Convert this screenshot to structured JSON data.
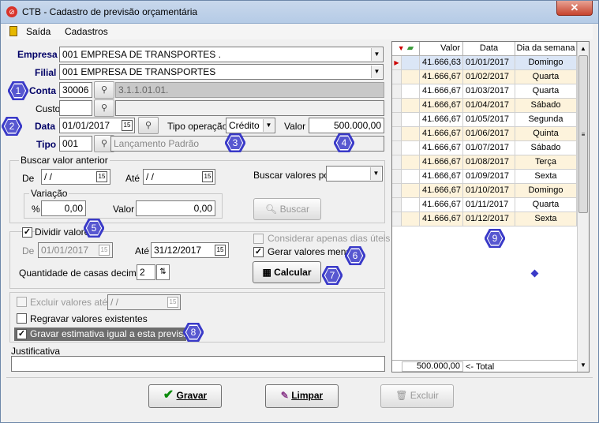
{
  "window": {
    "title": "CTB - Cadastro de previsão orçamentária",
    "close_label": "✕"
  },
  "menu": [
    {
      "label": "Saída"
    },
    {
      "label": "Cadastros"
    }
  ],
  "form": {
    "empresa_label": "Empresa",
    "empresa_value": "001 EMPRESA DE TRANSPORTES .",
    "filial_label": "Filial",
    "filial_value": "001 EMPRESA DE TRANSPORTES",
    "conta_label": "Conta",
    "conta_value": "30006",
    "conta_desc": "3.1.1.01.01.",
    "custo_label": "Custo",
    "custo_value": "",
    "data_label": "Data",
    "data_value": "01/01/2017",
    "tipo_operacao_label": "Tipo operação",
    "tipo_operacao_value": "Crédito",
    "valor_label": "Valor",
    "valor_value": "500.000,00",
    "tipo_label": "Tipo",
    "tipo_value": "001",
    "tipo_desc": "Lançamento Padrão"
  },
  "buscar": {
    "group_label": "Buscar valor anterior",
    "de_label": "De",
    "de_value": " / /",
    "ate_label": "Até",
    "ate_value": " / /",
    "buscar_por_label": "Buscar valores por",
    "buscar_por_value": "",
    "variacao_label": "Variação",
    "percent_label": "%",
    "percent_value": "0,00",
    "valor_label": "Valor",
    "valor_value": "0,00",
    "button_label": "Buscar"
  },
  "dividir": {
    "checkbox_label": "Dividir valores",
    "checked": true,
    "de_label": "De",
    "de_value": "01/01/2017",
    "ate_label": "Até",
    "ate_value": "31/12/2017",
    "dias_uteis_label": "Considerar apenas dias úteis",
    "mensais_label": "Gerar valores mensais",
    "mensais_checked": true,
    "casas_label": "Quantidade de casas decimais",
    "casas_value": "2",
    "calcular_label": "Calcular"
  },
  "options": {
    "excluir_label": "Excluir valores até",
    "excluir_value": " / /",
    "regravar_label": "Regravar valores existentes",
    "gravar_estimativa_label": "Gravar estimativa igual a esta previsão",
    "justificativa_label": "Justificativa",
    "justificativa_value": ""
  },
  "grid": {
    "columns": [
      "Valor",
      "Data",
      "Dia da semana"
    ],
    "rows": [
      {
        "valor": "41.666,63",
        "data": "01/01/2017",
        "dia": "Domingo"
      },
      {
        "valor": "41.666,67",
        "data": "01/02/2017",
        "dia": "Quarta"
      },
      {
        "valor": "41.666,67",
        "data": "01/03/2017",
        "dia": "Quarta"
      },
      {
        "valor": "41.666,67",
        "data": "01/04/2017",
        "dia": "Sábado"
      },
      {
        "valor": "41.666,67",
        "data": "01/05/2017",
        "dia": "Segunda"
      },
      {
        "valor": "41.666,67",
        "data": "01/06/2017",
        "dia": "Quinta"
      },
      {
        "valor": "41.666,67",
        "data": "01/07/2017",
        "dia": "Sábado"
      },
      {
        "valor": "41.666,67",
        "data": "01/08/2017",
        "dia": "Terça"
      },
      {
        "valor": "41.666,67",
        "data": "01/09/2017",
        "dia": "Sexta"
      },
      {
        "valor": "41.666,67",
        "data": "01/10/2017",
        "dia": "Domingo"
      },
      {
        "valor": "41.666,67",
        "data": "01/11/2017",
        "dia": "Quarta"
      },
      {
        "valor": "41.666,67",
        "data": "01/12/2017",
        "dia": "Sexta"
      }
    ],
    "total_value": "500.000,00",
    "total_label": "<- Total"
  },
  "footer": {
    "gravar_label": "Gravar",
    "limpar_label": "Limpar",
    "excluir_label": "Excluir"
  },
  "badges": [
    "1",
    "2",
    "3",
    "4",
    "5",
    "6",
    "7",
    "8",
    "9"
  ],
  "colors": {
    "badge": "#3a3ac8",
    "label_blue": "#000066",
    "row_highlight": "#fdf3dc",
    "row_selected": "#dbe6f6"
  }
}
